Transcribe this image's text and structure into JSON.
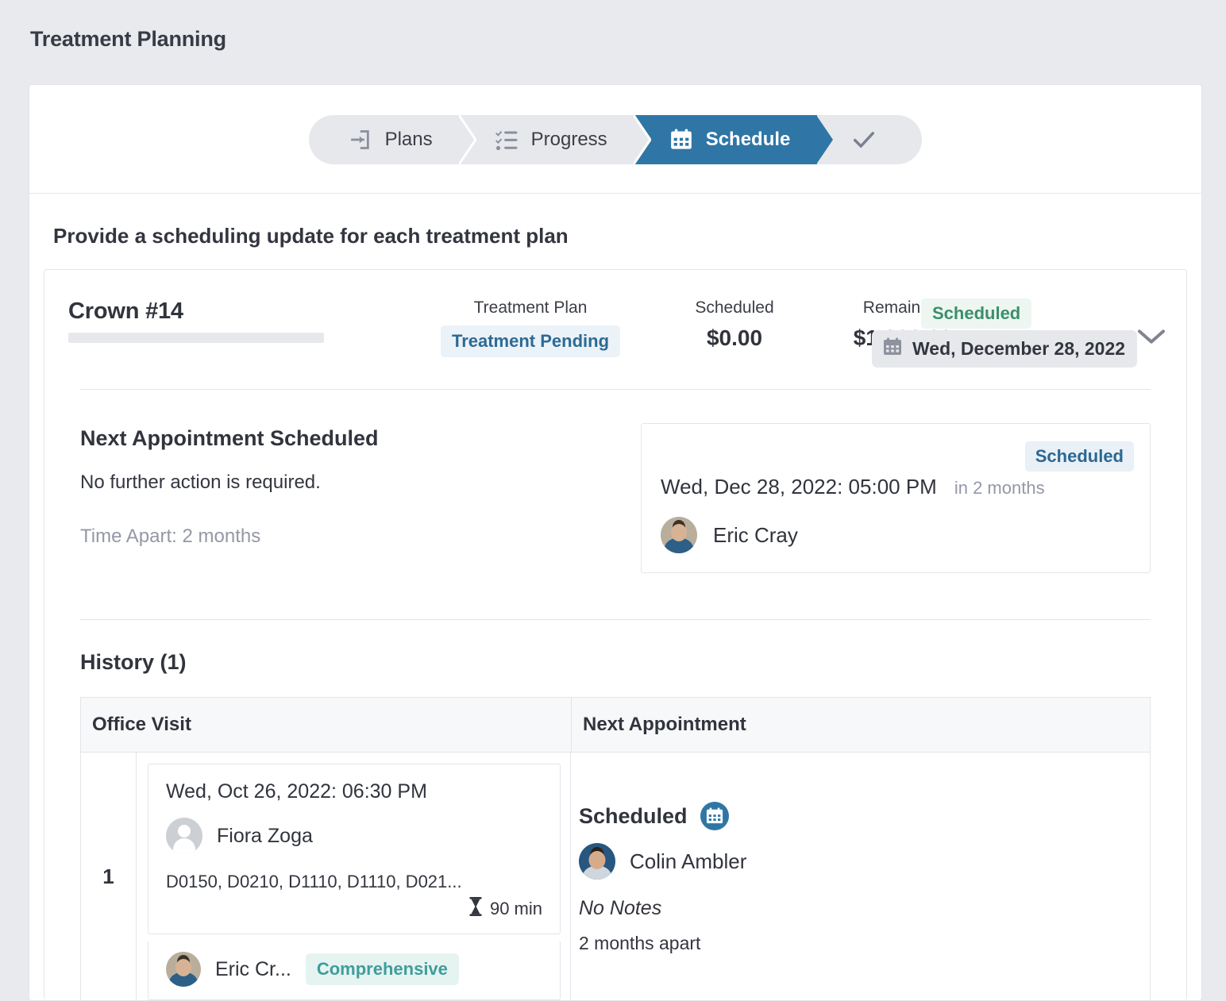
{
  "page": {
    "title": "Treatment Planning",
    "section_heading": "Provide a scheduling update for each treatment plan"
  },
  "stepper": {
    "steps": [
      {
        "label": "Plans",
        "icon": "sign-in-icon",
        "active": false
      },
      {
        "label": "Progress",
        "icon": "tasks-checklist-icon",
        "active": false
      },
      {
        "label": "Schedule",
        "icon": "calendar-icon",
        "active": true
      },
      {
        "label": "",
        "icon": "check-icon",
        "active": false
      }
    ]
  },
  "plan": {
    "name": "Crown #14",
    "treatment_plan_label": "Treatment Plan",
    "treatment_plan_badge": "Treatment Pending",
    "scheduled_label": "Scheduled",
    "scheduled_value": "$0.00",
    "remaining_label": "Remaining",
    "remaining_value": "$1,800.00",
    "status_badge": "Scheduled",
    "date_chip": "Wed, December 28, 2022",
    "chevron": "chevron-down-icon"
  },
  "next_appointment": {
    "title": "Next Appointment Scheduled",
    "subtitle": "No further action is required.",
    "time_apart": "Time Apart: 2 months",
    "card": {
      "status_badge": "Scheduled",
      "datetime": "Wed, Dec 28, 2022: 05:00 PM",
      "relative": "in 2 months",
      "provider": "Eric Cray"
    }
  },
  "history": {
    "title": "History (1)",
    "columns": [
      "Office Visit",
      "Next Appointment"
    ],
    "rows": [
      {
        "number": "1",
        "visit": {
          "datetime": "Wed, Oct 26, 2022: 06:30 PM",
          "patient": "Fiora Zoga",
          "codes": "D0150, D0210, D1110, D1110, D021...",
          "duration": "90 min",
          "duration_icon": "hourglass-icon",
          "next_provider": "Eric Cr...",
          "next_type_badge": "Comprehensive"
        },
        "next_appointment": {
          "status": "Scheduled",
          "status_icon": "calendar-circle-icon",
          "provider": "Colin Ambler",
          "notes": "No Notes",
          "apart": "2 months apart"
        }
      }
    ]
  },
  "colors": {
    "accent_blue": "#2f76a6",
    "badge_blue_bg": "#ebf2f8",
    "badge_blue_text": "#2c6a94",
    "badge_green_bg": "#edf6f1",
    "badge_green_text": "#3c8e6e",
    "badge_teal_bg": "#e6f4f1",
    "badge_teal_text": "#3f9d9b",
    "page_bg": "#e8eaed"
  }
}
